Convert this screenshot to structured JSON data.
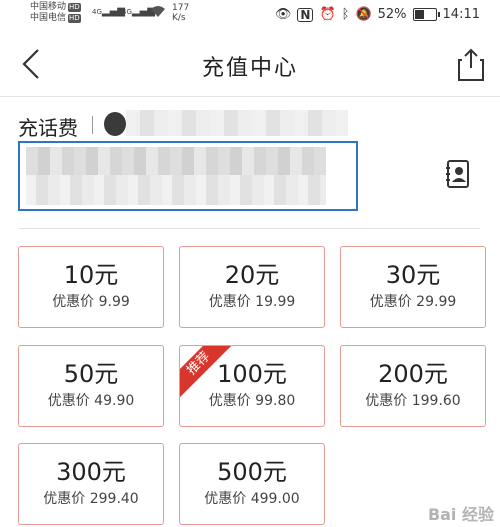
{
  "status_bar": {
    "carrier_1": "中国移动",
    "carrier_2": "中国电信",
    "hd": "HD",
    "net_1": "4G",
    "net_2": "4G",
    "speed_value": "177",
    "speed_unit": "K/s",
    "battery_percent": "52%",
    "battery_level": 0.52,
    "time": "14:11"
  },
  "header": {
    "title": "充值中心"
  },
  "phone": {
    "label": "充话费"
  },
  "cards": [
    {
      "amount": "10元",
      "price": "优惠价 9.99"
    },
    {
      "amount": "20元",
      "price": "优惠价 19.99"
    },
    {
      "amount": "30元",
      "price": "优惠价 29.99"
    },
    {
      "amount": "50元",
      "price": "优惠价 49.90"
    },
    {
      "amount": "100元",
      "price": "优惠价 99.80",
      "badge": "推荐"
    },
    {
      "amount": "200元",
      "price": "优惠价 199.60"
    },
    {
      "amount": "300元",
      "price": "优惠价 299.40"
    },
    {
      "amount": "500元",
      "price": "优惠价 499.00"
    }
  ],
  "watermark": "Bai 经验",
  "colors": {
    "accent_blue": "#2f74c8",
    "card_border": "#e79a94",
    "badge_red": "#d8362c"
  }
}
